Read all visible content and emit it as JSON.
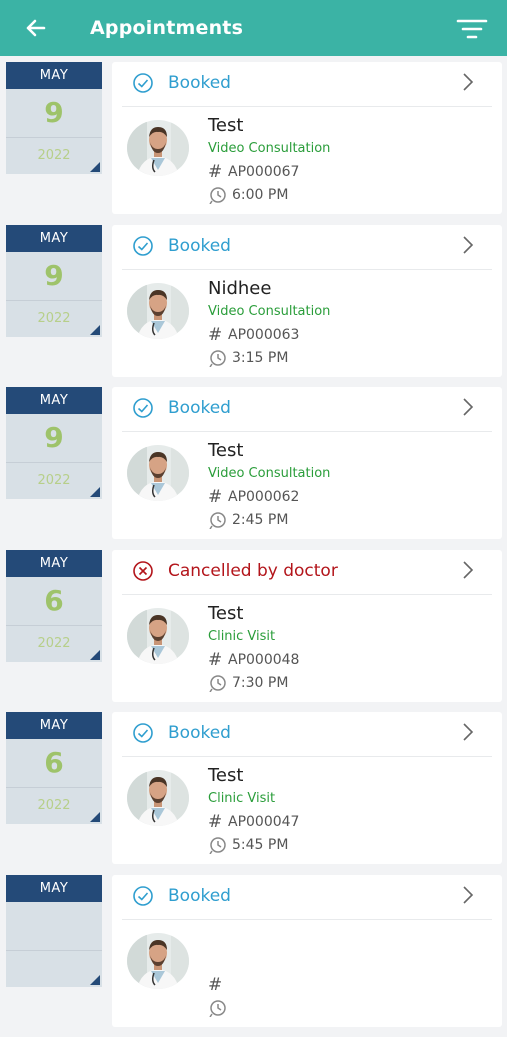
{
  "header": {
    "title": "Appointments",
    "back_icon": "arrow-left-icon",
    "filter_icon": "filter-icon",
    "color": "#3bb3a5"
  },
  "appointments": [
    {
      "month": "MAY",
      "day": "9",
      "year": "2022",
      "status": "Booked",
      "status_type": "booked",
      "doctor": "Test",
      "visit_type": "Video Consultation",
      "id": "AP000067",
      "time": "6:00 PM"
    },
    {
      "month": "MAY",
      "day": "9",
      "year": "2022",
      "status": "Booked",
      "status_type": "booked",
      "doctor": "Nidhee",
      "visit_type": "Video Consultation",
      "id": "AP000063",
      "time": "3:15 PM"
    },
    {
      "month": "MAY",
      "day": "9",
      "year": "2022",
      "status": "Booked",
      "status_type": "booked",
      "doctor": "Test",
      "visit_type": "Video Consultation",
      "id": "AP000062",
      "time": "2:45 PM"
    },
    {
      "month": "MAY",
      "day": "6",
      "year": "2022",
      "status": "Cancelled by doctor",
      "status_type": "cancelled",
      "doctor": "Test",
      "visit_type": "Clinic Visit",
      "id": "AP000048",
      "time": "7:30 PM"
    },
    {
      "month": "MAY",
      "day": "6",
      "year": "2022",
      "status": "Booked",
      "status_type": "booked",
      "doctor": "Test",
      "visit_type": "Clinic Visit",
      "id": "AP000047",
      "time": "5:45 PM"
    },
    {
      "month": "MAY",
      "day": "",
      "year": "",
      "status": "Booked",
      "status_type": "booked",
      "doctor": "",
      "visit_type": "",
      "id": "",
      "time": ""
    }
  ],
  "colors": {
    "booked": "#2f9ecf",
    "cancelled": "#b3151b",
    "visit_type": "#2a9d3a",
    "calendar_header": "#244a78",
    "calendar_day": "#9ec36a"
  }
}
